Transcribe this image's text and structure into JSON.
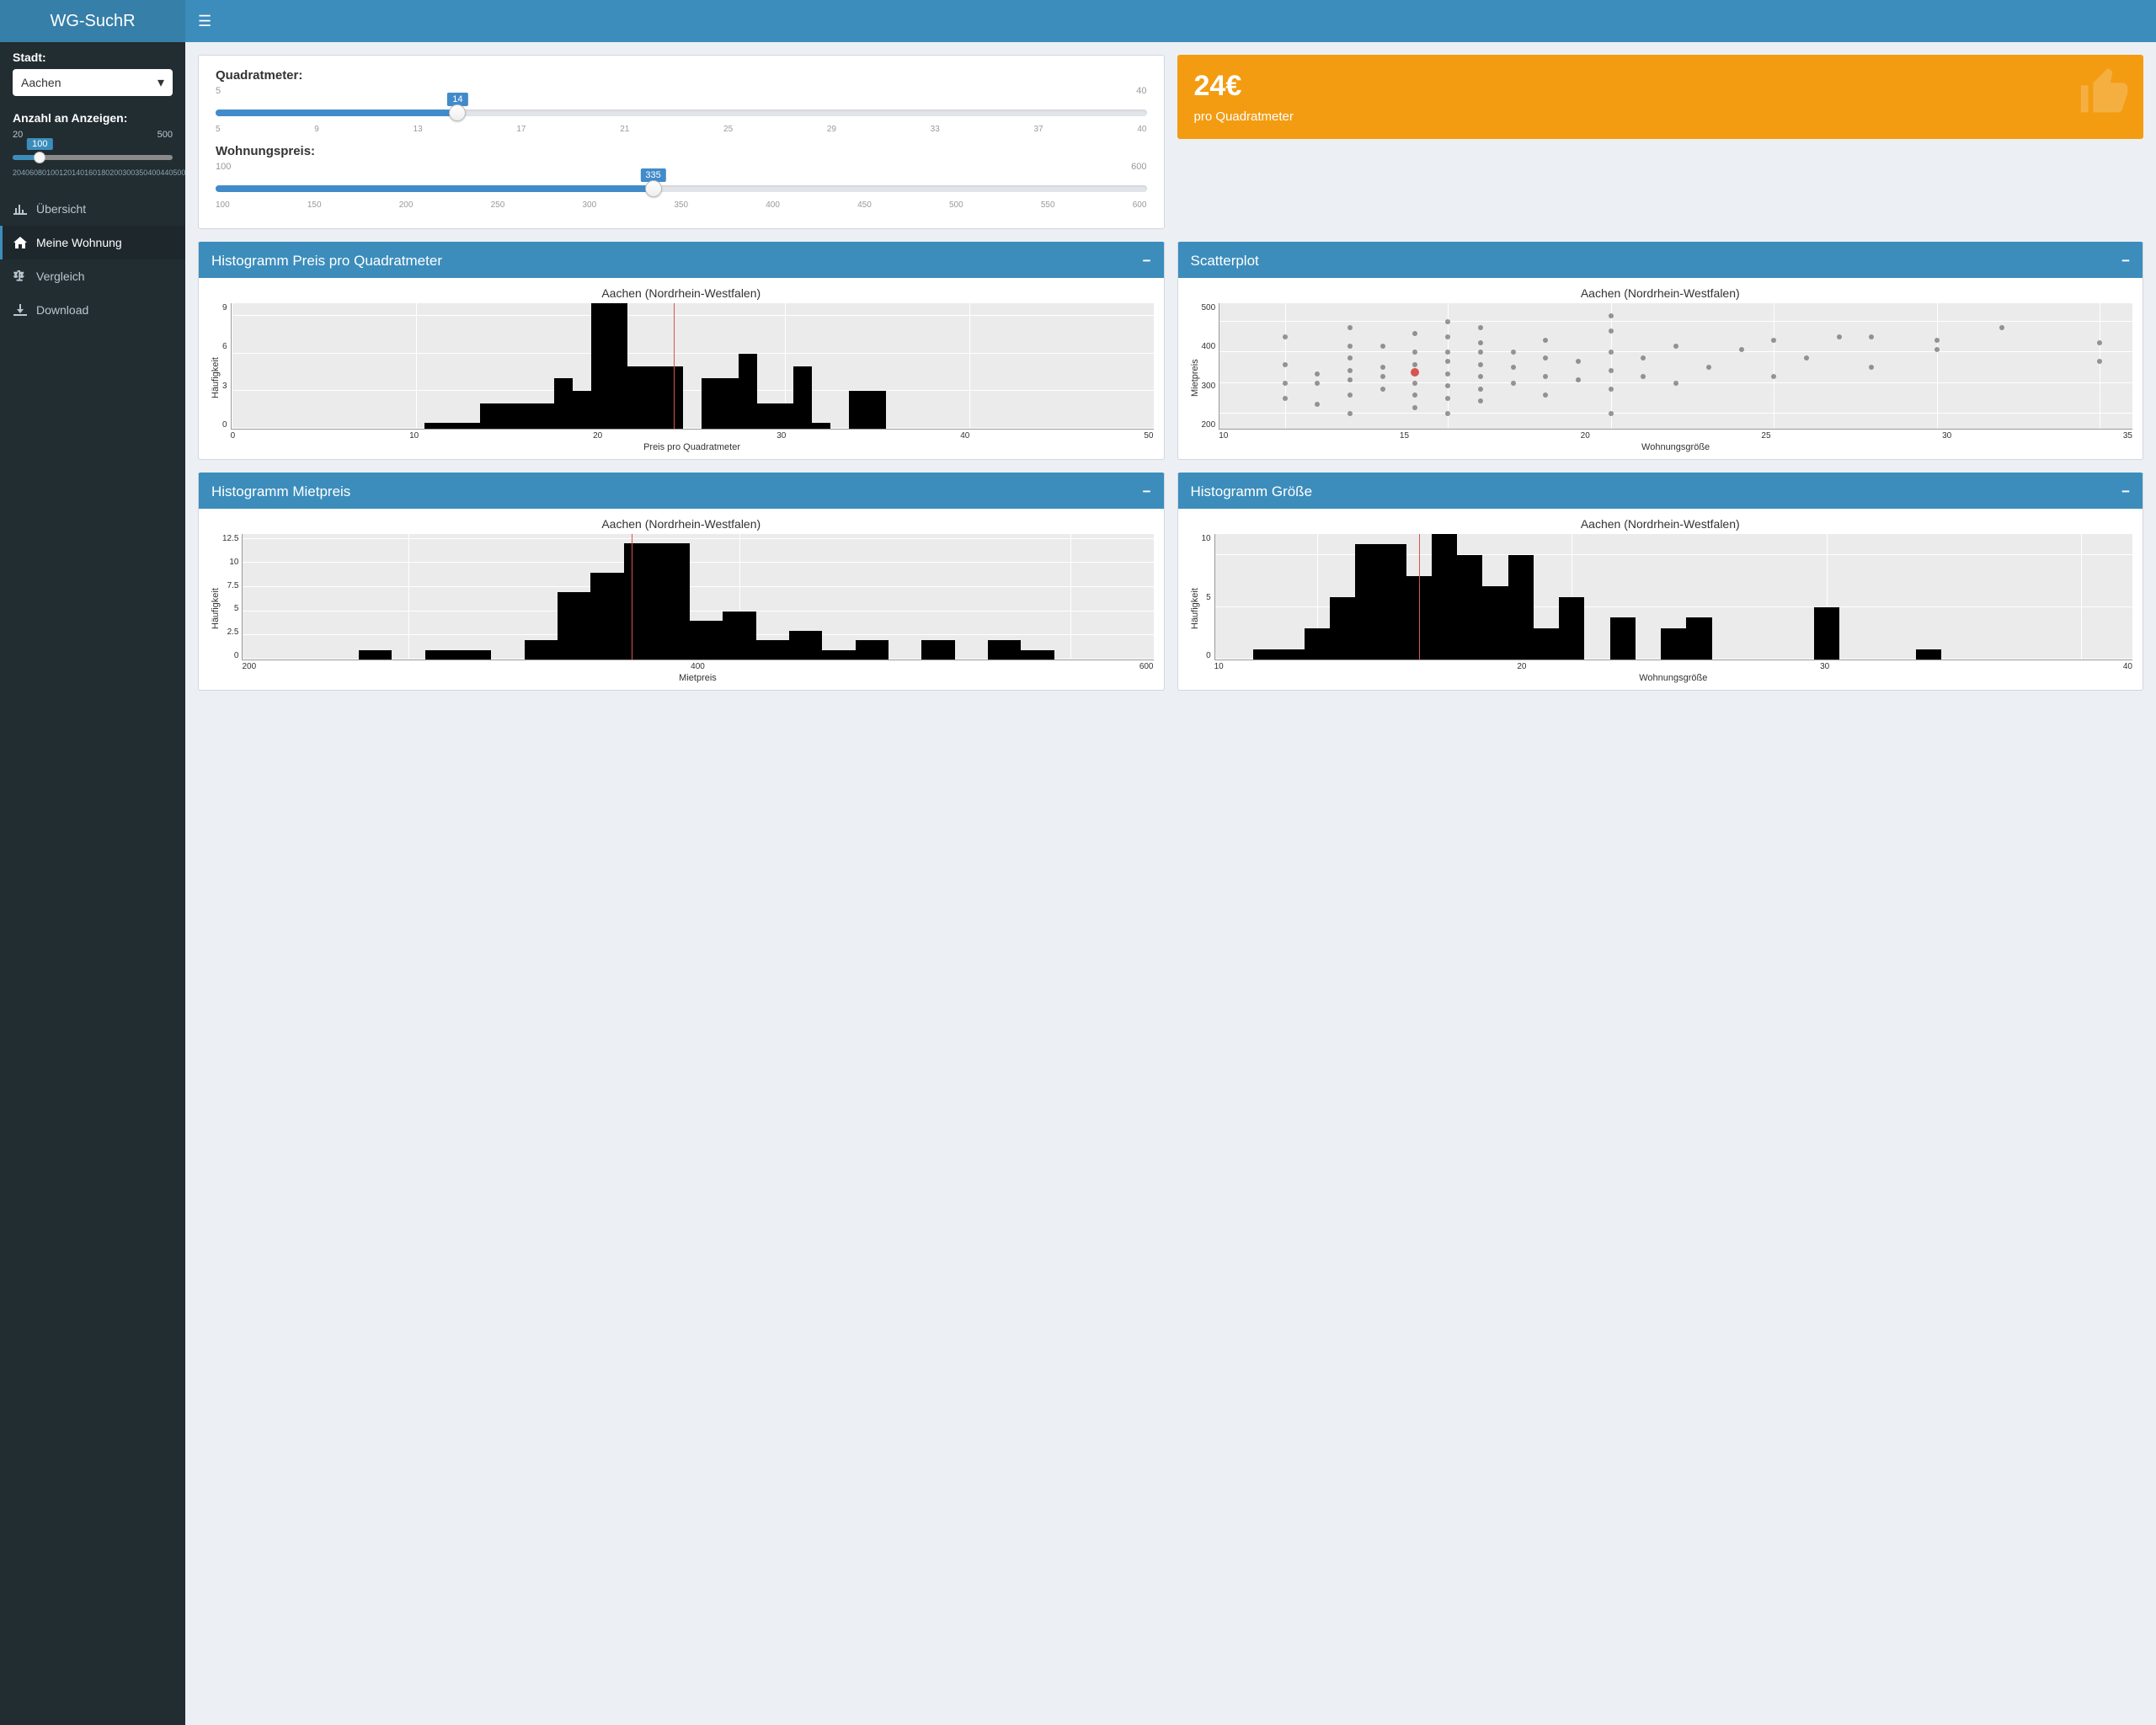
{
  "brand": "WG-SuchR",
  "sidebar": {
    "city_label": "Stadt:",
    "city_value": "Aachen",
    "count_label": "Anzahl an Anzeigen:",
    "count_min": "20",
    "count_max": "500",
    "count_value": "100",
    "count_ticks": [
      "20",
      "40",
      "60",
      "80",
      "100",
      "120",
      "140",
      "160",
      "180",
      "200",
      "300",
      "350",
      "400",
      "440",
      "500"
    ],
    "nav": [
      {
        "label": "Übersicht"
      },
      {
        "label": "Meine Wohnung"
      },
      {
        "label": "Vergleich"
      },
      {
        "label": "Download"
      }
    ]
  },
  "filters": {
    "sqm_label": "Quadratmeter:",
    "sqm_min": "5",
    "sqm_max": "40",
    "sqm_value": "14",
    "sqm_ticks": [
      "5",
      "9",
      "13",
      "17",
      "21",
      "25",
      "29",
      "33",
      "37",
      "40"
    ],
    "price_label": "Wohnungspreis:",
    "price_min": "100",
    "price_max": "600",
    "price_value": "335",
    "price_ticks": [
      "100",
      "150",
      "200",
      "250",
      "300",
      "350",
      "400",
      "450",
      "500",
      "550",
      "600"
    ]
  },
  "valuebox": {
    "value": "24€",
    "sub": "pro Quadratmeter"
  },
  "panels": {
    "hist_ppsqm": "Histogramm Preis pro Quadratmeter",
    "scatter": "Scatterplot",
    "hist_price": "Histogramm Mietpreis",
    "hist_size": "Histogramm Größe"
  },
  "chart_subtitle": "Aachen (Nordrhein-Westfalen)",
  "axis": {
    "hauf": "Häufigkeit",
    "ppsqm": "Preis pro Quadratmeter",
    "mietpreis": "Mietpreis",
    "wgr": "Wohnungsgröße"
  },
  "chart_data": [
    {
      "id": "hist_ppsqm",
      "type": "bar",
      "title": "Aachen (Nordrhein-Westfalen)",
      "xlabel": "Preis pro Quadratmeter",
      "ylabel": "Häufigkeit",
      "xlim": [
        0,
        50
      ],
      "ylim": [
        0,
        10
      ],
      "xticks": [
        0,
        10,
        20,
        30,
        40,
        50
      ],
      "yticks": [
        0,
        3,
        6,
        9
      ],
      "vline": 24,
      "x": [
        11,
        12,
        13,
        14,
        15,
        16,
        17,
        18,
        19,
        20,
        21,
        22,
        23,
        24,
        25,
        26,
        27,
        28,
        29,
        30,
        31,
        32,
        33,
        34,
        35,
        36
      ],
      "values": [
        0.5,
        0.5,
        0.5,
        2,
        2,
        2,
        2,
        4,
        3,
        10,
        10,
        5,
        5,
        5,
        0,
        4,
        4,
        6,
        2,
        2,
        5,
        0.5,
        0,
        3,
        3,
        0
      ]
    },
    {
      "id": "scatter",
      "type": "scatter",
      "title": "Aachen (Nordrhein-Westfalen)",
      "xlabel": "Wohnungsgröße",
      "ylabel": "Mietpreis",
      "xlim": [
        8,
        36
      ],
      "ylim": [
        150,
        560
      ],
      "xticks": [
        10,
        15,
        20,
        25,
        30,
        35
      ],
      "yticks": [
        200,
        300,
        400,
        500
      ],
      "highlight": {
        "x": 14,
        "y": 335
      },
      "points": [
        [
          10,
          250
        ],
        [
          10,
          300
        ],
        [
          10,
          360
        ],
        [
          10,
          450
        ],
        [
          11,
          230
        ],
        [
          11,
          300
        ],
        [
          11,
          330
        ],
        [
          12,
          200
        ],
        [
          12,
          260
        ],
        [
          12,
          310
        ],
        [
          12,
          340
        ],
        [
          12,
          380
        ],
        [
          12,
          420
        ],
        [
          12,
          480
        ],
        [
          13,
          280
        ],
        [
          13,
          320
        ],
        [
          13,
          350
        ],
        [
          13,
          420
        ],
        [
          14,
          220
        ],
        [
          14,
          260
        ],
        [
          14,
          300
        ],
        [
          14,
          330
        ],
        [
          14,
          360
        ],
        [
          14,
          400
        ],
        [
          14,
          460
        ],
        [
          15,
          200
        ],
        [
          15,
          250
        ],
        [
          15,
          290
        ],
        [
          15,
          330
        ],
        [
          15,
          370
        ],
        [
          15,
          400
        ],
        [
          15,
          450
        ],
        [
          15,
          500
        ],
        [
          16,
          240
        ],
        [
          16,
          280
        ],
        [
          16,
          320
        ],
        [
          16,
          360
        ],
        [
          16,
          400
        ],
        [
          16,
          430
        ],
        [
          16,
          480
        ],
        [
          17,
          300
        ],
        [
          17,
          350
        ],
        [
          17,
          400
        ],
        [
          18,
          260
        ],
        [
          18,
          320
        ],
        [
          18,
          380
        ],
        [
          18,
          440
        ],
        [
          19,
          310
        ],
        [
          19,
          370
        ],
        [
          20,
          200
        ],
        [
          20,
          280
        ],
        [
          20,
          340
        ],
        [
          20,
          400
        ],
        [
          20,
          470
        ],
        [
          20,
          520
        ],
        [
          21,
          320
        ],
        [
          21,
          380
        ],
        [
          22,
          300
        ],
        [
          22,
          420
        ],
        [
          23,
          350
        ],
        [
          24,
          410
        ],
        [
          25,
          320
        ],
        [
          25,
          440
        ],
        [
          26,
          380
        ],
        [
          27,
          450
        ],
        [
          28,
          350
        ],
        [
          28,
          450
        ],
        [
          30,
          410
        ],
        [
          30,
          440
        ],
        [
          32,
          480
        ],
        [
          35,
          370
        ],
        [
          35,
          430
        ]
      ]
    },
    {
      "id": "hist_price",
      "type": "bar",
      "title": "Aachen (Nordrhein-Westfalen)",
      "xlabel": "Mietpreis",
      "ylabel": "Häufigkeit",
      "xlim": [
        100,
        650
      ],
      "ylim": [
        0,
        13
      ],
      "xticks": [
        200,
        400,
        600
      ],
      "yticks": [
        0,
        2.5,
        5,
        7.5,
        10,
        12.5
      ],
      "vline": 335,
      "x": [
        180,
        200,
        220,
        240,
        260,
        280,
        300,
        320,
        340,
        360,
        380,
        400,
        420,
        440,
        460,
        480,
        500,
        520,
        540,
        560,
        580
      ],
      "values": [
        1,
        0,
        1,
        1,
        0,
        2,
        7,
        9,
        12,
        12,
        4,
        5,
        2,
        3,
        1,
        2,
        0,
        2,
        0,
        2,
        1
      ]
    },
    {
      "id": "hist_size",
      "type": "bar",
      "title": "Aachen (Nordrhein-Westfalen)",
      "xlabel": "Wohnungsgröße",
      "ylabel": "Häufigkeit",
      "xlim": [
        6,
        42
      ],
      "ylim": [
        0,
        12
      ],
      "xticks": [
        10,
        20,
        30,
        40
      ],
      "yticks": [
        0,
        5,
        10
      ],
      "vline": 14,
      "x": [
        8,
        9,
        10,
        11,
        12,
        13,
        14,
        15,
        16,
        17,
        18,
        19,
        20,
        21,
        22,
        23,
        24,
        25,
        26,
        27,
        28,
        30,
        31,
        34
      ],
      "values": [
        1,
        1,
        3,
        6,
        11,
        11,
        8,
        12,
        10,
        7,
        10,
        3,
        6,
        0,
        4,
        0,
        3,
        4,
        0,
        0,
        0,
        5,
        0,
        1
      ]
    }
  ]
}
